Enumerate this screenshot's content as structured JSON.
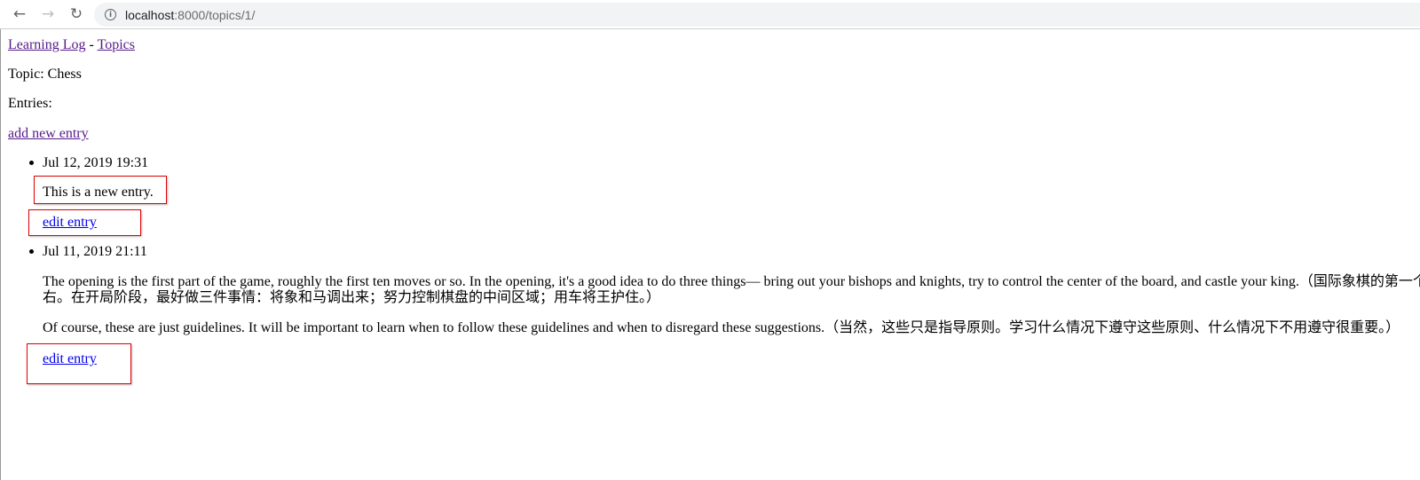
{
  "browser": {
    "url_host": "localhost",
    "url_path": ":8000/topics/1/",
    "icons": [
      "back-arrow-icon",
      "forward-arrow-icon",
      "reload-icon",
      "info-icon"
    ]
  },
  "header": {
    "home_link": "Learning Log",
    "separator": "-",
    "topics_link": "Topics"
  },
  "topic": {
    "line": "Topic: Chess"
  },
  "entries_label": "Entries:",
  "add_entry_link": "add new entry",
  "entries": [
    {
      "date": "Jul 12, 2019 19:31",
      "paragraphs": [
        "This is a new entry."
      ],
      "edit_link": "edit entry"
    },
    {
      "date": "Jul 11, 2019 21:11",
      "paragraphs": [
        "The opening is the first part of the game, roughly the first ten moves or so. In the opening, it's a good idea to do three things— bring out your bishops and knights, try to control the center of the board, and castle your king.（国际象棋的第一个",
        "右。在开局阶段，最好做三件事情：将象和马调出来；努力控制棋盘的中间区域；用车将王护住。）",
        "Of course, these are just guidelines. It will be important to learn when to follow these guidelines and when to disregard these suggestions.（当然，这些只是指导原则。学习什么情况下遵守这些原则、什么情况下不用遵守很重要。）"
      ],
      "edit_link": "edit entry"
    }
  ],
  "colors": {
    "annotation_box": "#e00000",
    "link": "#0000ee",
    "visited_link": "#551a8b"
  }
}
